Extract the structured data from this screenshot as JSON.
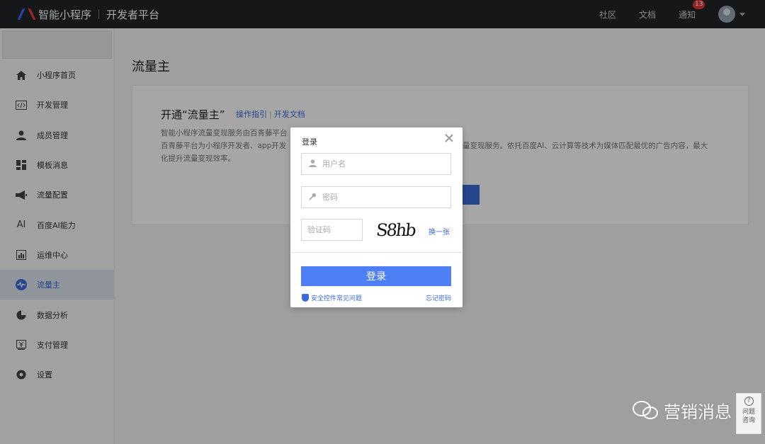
{
  "header": {
    "brand": "智能小程序",
    "brand_sub": "开发者平台",
    "nav": {
      "community": "社区",
      "docs": "文档",
      "notify": "通知",
      "notify_count": "13"
    }
  },
  "sidebar": {
    "items": [
      {
        "label": "小程序首页",
        "icon": "home-icon"
      },
      {
        "label": "开发管理",
        "icon": "code-icon"
      },
      {
        "label": "成员管理",
        "icon": "user-icon"
      },
      {
        "label": "模板消息",
        "icon": "template-icon"
      },
      {
        "label": "流量配置",
        "icon": "megaphone-icon"
      },
      {
        "label": "百度AI能力",
        "icon": "ai-icon"
      },
      {
        "label": "运维中心",
        "icon": "chart-icon"
      },
      {
        "label": "流量主",
        "icon": "pulse-icon",
        "active": true
      },
      {
        "label": "数据分析",
        "icon": "pie-icon"
      },
      {
        "label": "支付管理",
        "icon": "yen-icon"
      },
      {
        "label": "设置",
        "icon": "gear-icon"
      }
    ]
  },
  "main": {
    "title": "流量主",
    "card": {
      "title": "开通“流量主”",
      "link_guide": "操作指引",
      "link_docs": "开发文档",
      "desc_line1": "智能小程序流量变现服务由百青藤平台",
      "desc_line2": "百青藤平台为小程序开发者、app开发",
      "desc_line2_tail": "量变现服务。依托百度AI、云计算等技术为媒体匹配最优的广告内容，最大",
      "desc_line3": "化提升流量变现效率。"
    }
  },
  "modal": {
    "title": "登录",
    "username_placeholder": "用户名",
    "password_placeholder": "密码",
    "captcha_placeholder": "验证码",
    "captcha_text": "S8hb",
    "refresh": "换一张",
    "login": "登录",
    "help": "安全控件常见问题",
    "forgot": "忘记密码"
  },
  "watermark": "营销消息",
  "help_widget": {
    "icon": "?",
    "label": "问题咨询"
  }
}
